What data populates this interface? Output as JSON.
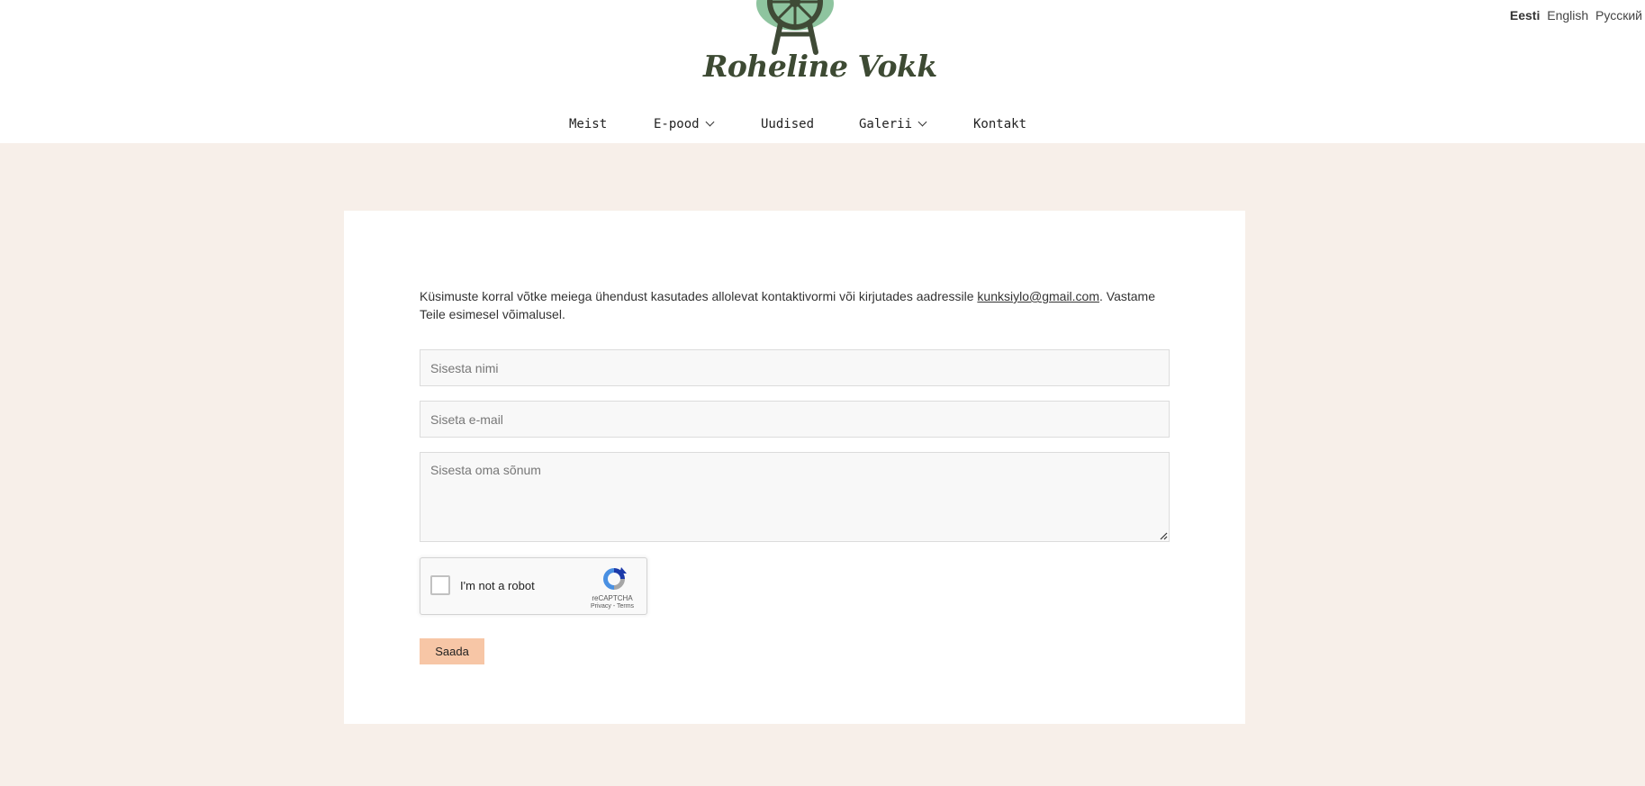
{
  "brand": {
    "name": "Roheline Vokk",
    "logo_icon": "spinning-wheel-logo",
    "logo_colors": {
      "circle": "#8ec49f",
      "wheel": "#3f4a36"
    }
  },
  "languages": [
    {
      "label": "Eesti",
      "active": true
    },
    {
      "label": "English",
      "active": false
    },
    {
      "label": "Русский",
      "active": false
    }
  ],
  "nav": {
    "items": [
      {
        "label": "Meist",
        "has_dropdown": false
      },
      {
        "label": "E-pood",
        "has_dropdown": true
      },
      {
        "label": "Uudised",
        "has_dropdown": false
      },
      {
        "label": "Galerii",
        "has_dropdown": true
      },
      {
        "label": "Kontakt",
        "has_dropdown": false
      }
    ]
  },
  "contact": {
    "intro_before": "Küsimuste korral võtke meiega ühendust kasutades allolevat kontaktivormi või kirjutades aadressile ",
    "email": "kunksiylo@gmail.com",
    "intro_after": ". Vastame Teile esimesel võimalusel.",
    "name_placeholder": "Sisesta nimi",
    "email_placeholder": "Siseta e-mail",
    "message_placeholder": "Sisesta oma sõnum",
    "submit_label": "Saada"
  },
  "recaptcha": {
    "label": "I'm not a robot",
    "brand": "reCAPTCHA",
    "links": "Privacy - Terms"
  },
  "colors": {
    "page_bg": "#f7efe9",
    "submit_bg": "#f7c6a6",
    "field_bg": "#f8f8f8"
  }
}
